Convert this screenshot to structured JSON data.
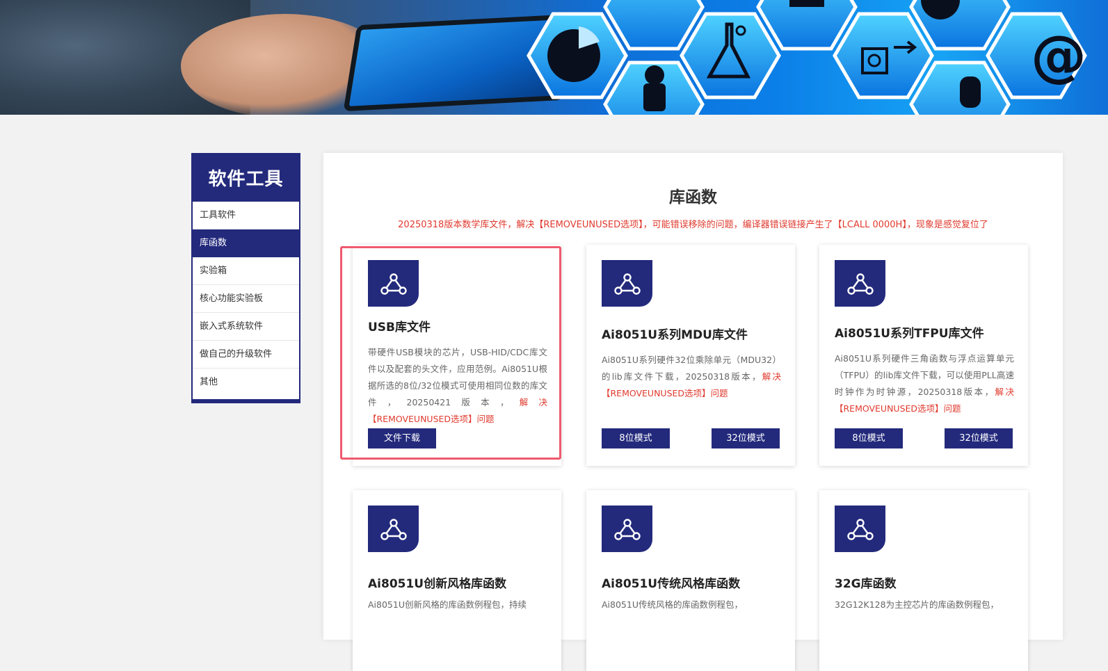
{
  "sidebar": {
    "title": "软件工具",
    "items": [
      {
        "label": "工具软件",
        "active": false
      },
      {
        "label": "库函数",
        "active": true
      },
      {
        "label": "实验箱",
        "active": false
      },
      {
        "label": "核心功能实验板",
        "active": false
      },
      {
        "label": "嵌入式系统软件",
        "active": false
      },
      {
        "label": "做自己的升级软件",
        "active": false
      },
      {
        "label": "其他",
        "active": false
      }
    ]
  },
  "main": {
    "title": "库函数",
    "notice": "20250318版本数学库文件，解决【REMOVEUNUSED选项】，可能错误移除的问题，编译器错误链接产生了【LCALL 0000H】，现象是感觉复位了"
  },
  "cards": [
    {
      "title": "USB库文件",
      "desc": "带硬件USB模块的芯片，USB-HID/CDC库文件以及配套的头文件，应用范例。Ai8051U根据所选的8位/32位模式可使用相同位数的库文件，20250421版本，",
      "desc_red": "解决【REMOVEUNUSED选项】问题",
      "buttons": [
        "文件下载"
      ]
    },
    {
      "title": "Ai8051U系列MDU库文件",
      "desc": "Ai8051U系列硬件32位乘除单元（MDU32）的lib库文件下载，20250318版本，",
      "desc_red": "解决【REMOVEUNUSED选项】问题",
      "buttons": [
        "8位模式",
        "32位模式"
      ]
    },
    {
      "title": "Ai8051U系列TFPU库文件",
      "desc": "Ai8051U系列硬件三角函数与浮点运算单元（TFPU）的lib库文件下载，可以使用PLL高速时钟作为时钟源，20250318版本，",
      "desc_red": "解决【REMOVEUNUSED选项】问题",
      "buttons": [
        "8位模式",
        "32位模式"
      ]
    },
    {
      "title": "Ai8051U创新风格库函数",
      "desc": "Ai8051U创新风格的库函数例程包，持续",
      "desc_red": "",
      "buttons": []
    },
    {
      "title": "Ai8051U传统风格库函数",
      "desc": "Ai8051U传统风格的库函数例程包，",
      "desc_red": "",
      "buttons": []
    },
    {
      "title": "32G库函数",
      "desc": "32G12K128为主控芯片的库函数例程包，",
      "desc_red": "",
      "buttons": []
    }
  ],
  "icons": {
    "card_badge": "share-network-icon"
  },
  "colors": {
    "brand": "#232a7c",
    "notice_red": "#e03a2e",
    "highlight": "#ef5a6e",
    "page_bg": "#f2f2f2"
  }
}
